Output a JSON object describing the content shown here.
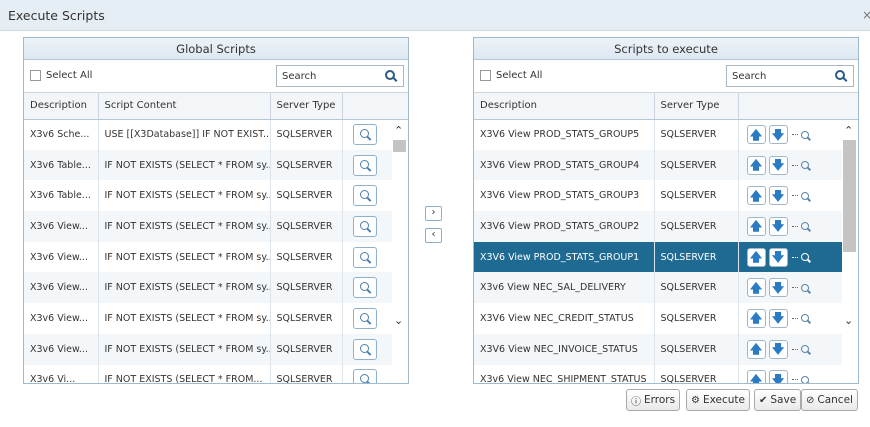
{
  "window": {
    "title": "Execute Scripts",
    "close": "×"
  },
  "global": {
    "header": "Global Scripts",
    "select_all": "Select All",
    "search_placeholder": "Search",
    "columns": [
      "Description",
      "Script Content",
      "Server Type",
      ""
    ],
    "rows": [
      {
        "desc": "X3v6 Sche...",
        "content": "USE [[X3Database]] IF NOT EXIST...",
        "type": "SQLSERVER"
      },
      {
        "desc": "X3v6 Table...",
        "content": "IF NOT EXISTS (SELECT * FROM sy...",
        "type": "SQLSERVER"
      },
      {
        "desc": "X3v6 Table...",
        "content": "IF NOT EXISTS (SELECT * FROM sy...",
        "type": "SQLSERVER"
      },
      {
        "desc": "X3v6 View...",
        "content": "IF NOT EXISTS (SELECT * FROM sy...",
        "type": "SQLSERVER"
      },
      {
        "desc": "X3v6 View...",
        "content": "IF NOT EXISTS (SELECT * FROM sy...",
        "type": "SQLSERVER"
      },
      {
        "desc": "X3v6 View...",
        "content": "IF NOT EXISTS (SELECT * FROM sy...",
        "type": "SQLSERVER"
      },
      {
        "desc": "X3v6 View...",
        "content": "IF NOT EXISTS (SELECT * FROM sy...",
        "type": "SQLSERVER"
      },
      {
        "desc": "X3v6 View...",
        "content": "IF NOT EXISTS (SELECT * FROM sy...",
        "type": "SQLSERVER"
      },
      {
        "desc": "X3v6 Vi...",
        "content": "IF NOT EXISTS (SELECT * FROM...",
        "type": "SQLSERVER"
      }
    ]
  },
  "execute": {
    "header": "Scripts to execute",
    "select_all": "Select All",
    "search_placeholder": "Search",
    "columns": [
      "Description",
      "Server Type",
      ""
    ],
    "rows": [
      {
        "desc": "X3V6 View PROD_STATS_GROUP5",
        "type": "SQLSERVER"
      },
      {
        "desc": "X3V6 View PROD_STATS_GROUP4",
        "type": "SQLSERVER"
      },
      {
        "desc": "X3V6 View PROD_STATS_GROUP3",
        "type": "SQLSERVER"
      },
      {
        "desc": "X3V6 View PROD_STATS_GROUP2",
        "type": "SQLSERVER"
      },
      {
        "desc": "X3V6 View PROD_STATS_GROUP1",
        "type": "SQLSERVER",
        "selected": true
      },
      {
        "desc": "X3v6 View NEC_SAL_DELIVERY",
        "type": "SQLSERVER"
      },
      {
        "desc": "X3V6 View NEC_CREDIT_STATUS",
        "type": "SQLSERVER"
      },
      {
        "desc": "X3V6 View NEC_INVOICE_STATUS",
        "type": "SQLSERVER"
      },
      {
        "desc": "X3v6 View NEC_SHIPMENT_STATUS",
        "type": "SQLSERVER"
      }
    ]
  },
  "transfer": {
    "add": "›",
    "remove": "‹"
  },
  "buttons": {
    "errors": "Errors",
    "execute": "Execute",
    "save": "Save",
    "cancel": "Cancel"
  },
  "colors": {
    "selected_row": "#1e6a93",
    "arrow": "#2a7bc4",
    "header_bg": "#e6eef5"
  }
}
